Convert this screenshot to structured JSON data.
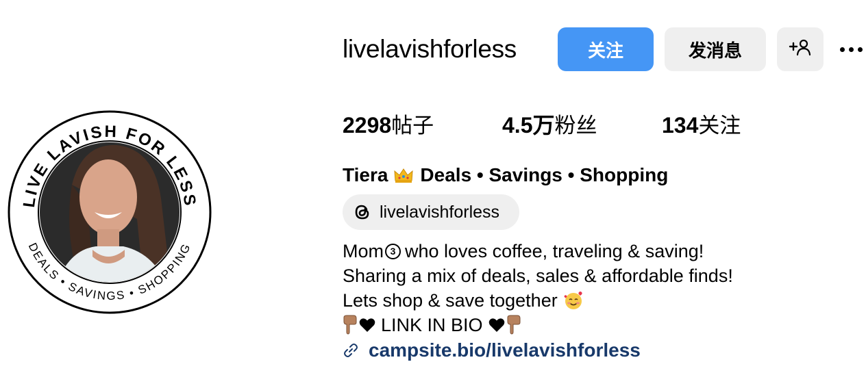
{
  "profile": {
    "username": "livelavishforless",
    "avatar_ring_top": "LIVE LAVISH FOR LESS",
    "avatar_ring_bottom": "DEALS • SAVINGS • SHOPPING"
  },
  "actions": {
    "follow_label": "关注",
    "message_label": "发消息",
    "add_person_icon": "person-add-icon",
    "more_icon": "more-dots-icon"
  },
  "stats": [
    {
      "value": "2298",
      "label": "帖子"
    },
    {
      "value": "4.5万",
      "label": "粉丝"
    },
    {
      "value": "134",
      "label": "关注"
    }
  ],
  "bio": {
    "name_first": "Tiera",
    "name_rest": "Deals • Savings • Shopping",
    "threads_handle": "livelavishforless",
    "line1_prefix": "Mom",
    "line1_circled": "3",
    "line1_rest": "who loves coffee, traveling & saving!",
    "line2": "Sharing a mix of deals, sales & affordable finds!",
    "line3": "Lets shop & save together",
    "line4": "LINK IN BIO",
    "link": "campsite.bio/livelavishforless"
  },
  "colors": {
    "follow_button": "#4596f5",
    "secondary_button": "#efefef",
    "link_text": "#18396a"
  }
}
